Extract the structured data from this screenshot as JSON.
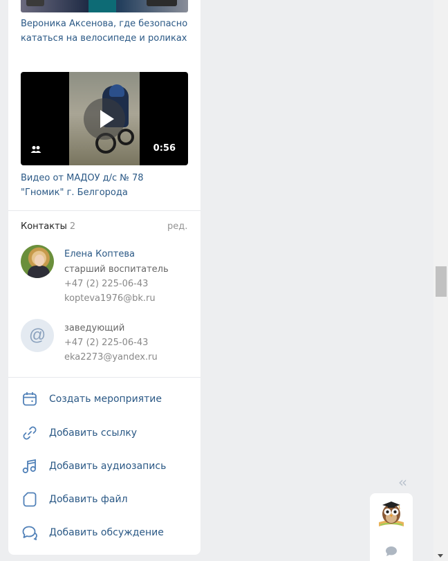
{
  "videos": [
    {
      "title": "Вероника Аксенова, где безопасно кататься на велосипеде и роликах"
    },
    {
      "title": "Видео от МАДОУ д/с № 78 \"Гномик\" г. Белгорода",
      "duration": "0:56"
    }
  ],
  "contacts": {
    "title": "Контакты",
    "count": "2",
    "edit_label": "ред.",
    "items": [
      {
        "name": "Елена Коптева",
        "role": "старший воспитатель",
        "phone": "+47 (2) 225-06-43",
        "email": "kopteva1976@bk.ru",
        "avatar": "photo"
      },
      {
        "name": "",
        "role": "заведующий",
        "phone": "+47 (2) 225-06-43",
        "email": "eka2273@yandex.ru",
        "avatar": "at-icon"
      }
    ]
  },
  "actions": [
    {
      "label": "Создать мероприятие",
      "icon": "calendar-icon"
    },
    {
      "label": "Добавить ссылку",
      "icon": "link-icon"
    },
    {
      "label": "Добавить аудиозапись",
      "icon": "music-note-icon"
    },
    {
      "label": "Добавить файл",
      "icon": "file-icon"
    },
    {
      "label": "Добавить обсуждение",
      "icon": "discussion-icon"
    }
  ],
  "colors": {
    "link": "#2a5885",
    "background": "#edeef0",
    "icon": "#5181b8",
    "muted": "#939393"
  }
}
